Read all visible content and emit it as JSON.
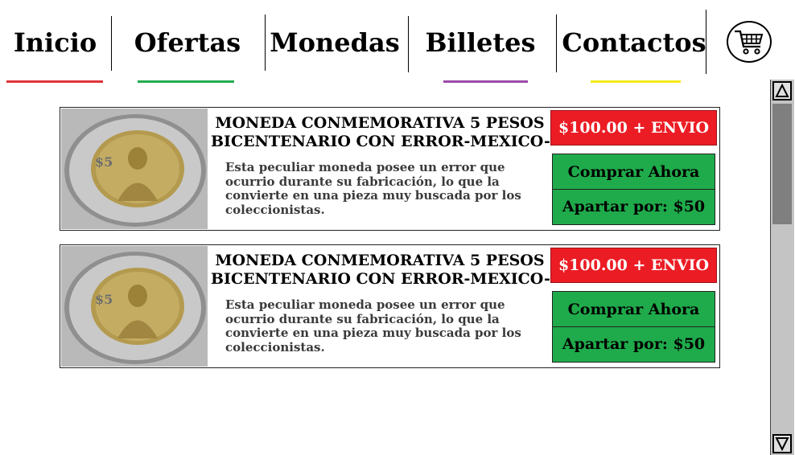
{
  "nav": {
    "items": [
      {
        "label": "Inicio",
        "underline": "#e0343b"
      },
      {
        "label": "Ofertas",
        "underline": "#22ab4e"
      },
      {
        "label": "Monedas",
        "underline": ""
      },
      {
        "label": "Billetes",
        "underline": "#9b4aa8"
      },
      {
        "label": "Contactos",
        "underline": "#f4ea1f"
      }
    ],
    "cart_icon": "shopping-cart-icon"
  },
  "products": [
    {
      "title_line1": "MONEDA CONMEMORATIVA 5 PESOS",
      "title_line2": "BICENTENARIO CON ERROR-MEXICO-",
      "description": "Esta peculiar moneda posee un error que ocurrio durante su fabricación, lo que la convierte en una pieza muy buscada por los coleccionistas.",
      "price": "$100.00 + ENVIO",
      "buy_label": "Comprar Ahora",
      "reserve_label": "Apartar por: $50"
    },
    {
      "title_line1": "MONEDA CONMEMORATIVA 5 PESOS",
      "title_line2": "BICENTENARIO CON ERROR-MEXICO-",
      "description": "Esta peculiar moneda posee un error que ocurrio durante su fabricación, lo que la convierte en una pieza muy buscada por los coleccionistas.",
      "price": "$100.00 + ENVIO",
      "buy_label": "Comprar Ahora",
      "reserve_label": "Apartar por: $50"
    }
  ],
  "colors": {
    "price_bg": "#ec1c24",
    "button_bg": "#1fab4b"
  },
  "scrollbar": {
    "up_icon": "arrow-up-icon",
    "down_icon": "arrow-down-icon"
  }
}
